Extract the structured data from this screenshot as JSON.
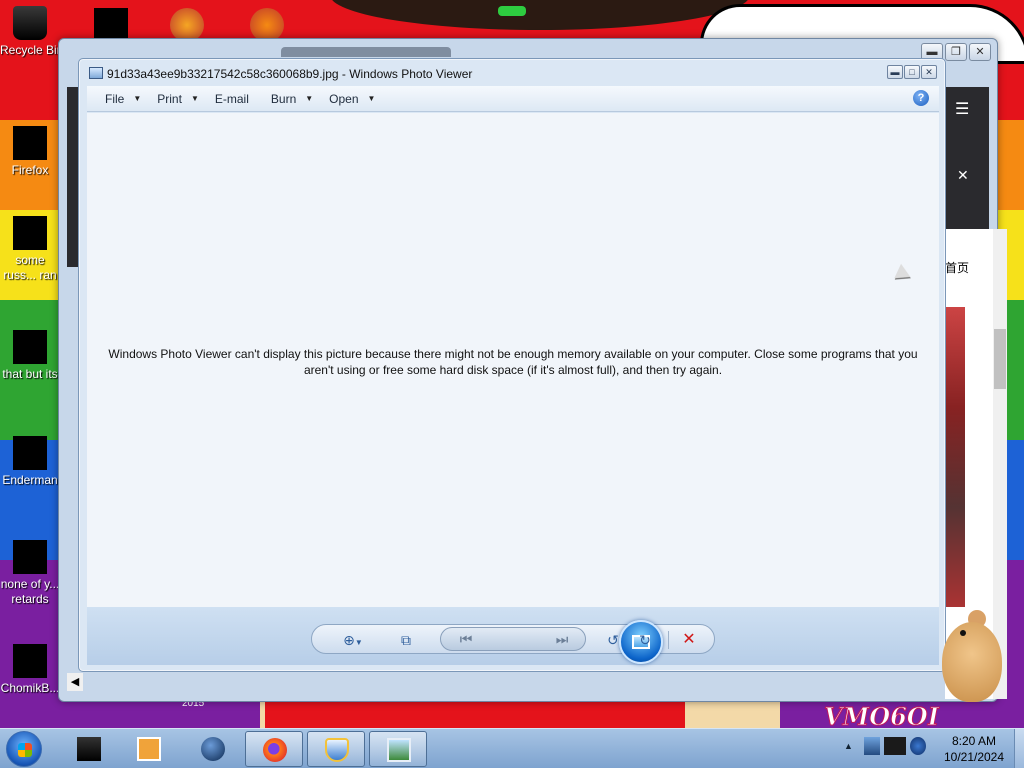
{
  "desktop": {
    "icons": [
      {
        "label": "Recycle Bin",
        "icon": "recycle-bin-icon"
      },
      {
        "label": "Firefox",
        "icon": "firefox-icon"
      },
      {
        "label": "some russ... ran a ra...",
        "icon": "file-icon"
      },
      {
        "label": "that but its",
        "icon": "stack-icon"
      },
      {
        "label": "Enderman",
        "icon": "terminal-icon"
      },
      {
        "label": "none of y... retards kn...",
        "icon": "app-icon"
      },
      {
        "label": "ChomikB...",
        "icon": "hamster-icon"
      }
    ],
    "wallpaper_logo": "VMO6OI",
    "wallpaper_year": "2015"
  },
  "background_window": {
    "chinese_text": "首页",
    "menu_icon": "hamburger-icon",
    "close_icon": "close-icon"
  },
  "photo_viewer": {
    "title": "91d33a43ee9b33217542c58c360068b9.jpg - Windows Photo Viewer",
    "menu": {
      "file": "File",
      "print": "Print",
      "email": "E-mail",
      "burn": "Burn",
      "open": "Open",
      "help": "?"
    },
    "message": "Windows Photo Viewer can't display this picture because there might not be enough memory available on your computer.  Close some programs that you aren't using or free some hard disk space (if it's almost full), and then try again.",
    "toolbar": {
      "zoom": "zoom-icon",
      "actual_size": "fit-window-icon",
      "previous": "previous-icon",
      "slideshow": "slideshow-icon",
      "next": "next-icon",
      "rotate_left": "rotate-counterclockwise-icon",
      "rotate_right": "rotate-clockwise-icon",
      "delete": "delete-icon"
    }
  },
  "taskbar": {
    "apps": [
      {
        "name": "app-1",
        "icon": "black-box-icon",
        "open": false
      },
      {
        "name": "media-player",
        "icon": "media-player-icon",
        "open": false
      },
      {
        "name": "globe",
        "icon": "globe-icon",
        "open": false
      },
      {
        "name": "firefox",
        "icon": "firefox-icon",
        "open": true
      },
      {
        "name": "security",
        "icon": "shield-icon",
        "open": true
      },
      {
        "name": "photo-viewer",
        "icon": "photo-viewer-icon",
        "open": true
      }
    ],
    "clock": {
      "time": "8:20 AM",
      "date": "10/21/2024"
    }
  },
  "colors": {
    "accent": "#1b5fc0",
    "delete": "#d01818",
    "viewer_background": "#f1f5fa"
  }
}
